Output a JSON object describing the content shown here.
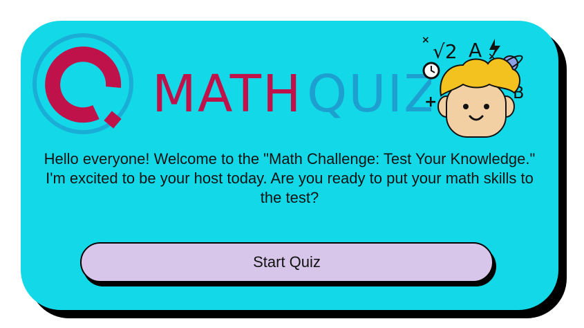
{
  "logo": {
    "word1": "MATH",
    "word2": "QUIZ"
  },
  "intro_text": "Hello everyone! Welcome to the \"Math Challenge: Test Your Knowledge.\" I'm excited to be your host today. Are you ready to put your math skills to the test?",
  "start_button": {
    "label": "Start Quiz"
  },
  "illustration": {
    "symbols": [
      "√2",
      "A",
      "B",
      "+",
      "×"
    ]
  },
  "colors": {
    "card_background": "#13d8e8",
    "logo_crimson": "#c0124a",
    "logo_blue": "#1d9fd0",
    "button_background": "#d7c6ea"
  },
  "icons": [
    "quiz-q-logo-icon",
    "clock-icon",
    "lightning-icon",
    "planet-icon",
    "thinking-boy-icon"
  ]
}
